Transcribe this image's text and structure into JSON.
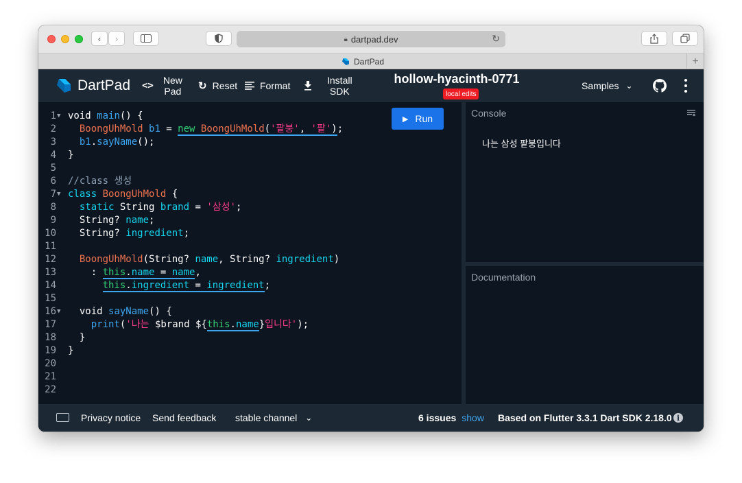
{
  "browser": {
    "url": "dartpad.dev",
    "tab_title": "DartPad"
  },
  "header": {
    "logo_text": "DartPad",
    "new_pad_line1": "New",
    "new_pad_line2": "Pad",
    "reset_label": "Reset",
    "format_label": "Format",
    "install_line1": "Install",
    "install_line2": "SDK",
    "pad_title": "hollow-hyacinth-0771",
    "badge": "local edits",
    "samples_label": "Samples"
  },
  "editor": {
    "run_label": "Run",
    "line_numbers": [
      "1",
      "2",
      "3",
      "4",
      "5",
      "6",
      "7",
      "8",
      "9",
      "10",
      "11",
      "12",
      "13",
      "14",
      "15",
      "16",
      "17",
      "18",
      "19",
      "20",
      "21",
      "22"
    ]
  },
  "console": {
    "title": "Console",
    "output": "나는 삼성 팥붕입니다"
  },
  "docs": {
    "title": "Documentation"
  },
  "footer": {
    "privacy": "Privacy notice",
    "feedback": "Send feedback",
    "channel": "stable channel",
    "issues": "6 issues",
    "show": "show",
    "version": "Based on Flutter 3.3.1 Dart SDK 2.18.0"
  },
  "colors": {
    "header_bg": "#1c2834",
    "editor_bg": "#0d1520",
    "run_button": "#1a73e8",
    "badge": "#ef1c24",
    "keyword": "#15d6f0",
    "class_name": "#f0734f",
    "string": "#ff3a8a"
  },
  "icons": [
    "dart-logo-icon",
    "code-icon",
    "refresh-icon",
    "format-icon",
    "download-icon",
    "chevron-down-icon",
    "github-icon",
    "more-vert-icon",
    "play-icon",
    "clear-console-icon",
    "keyboard-icon",
    "info-icon"
  ]
}
